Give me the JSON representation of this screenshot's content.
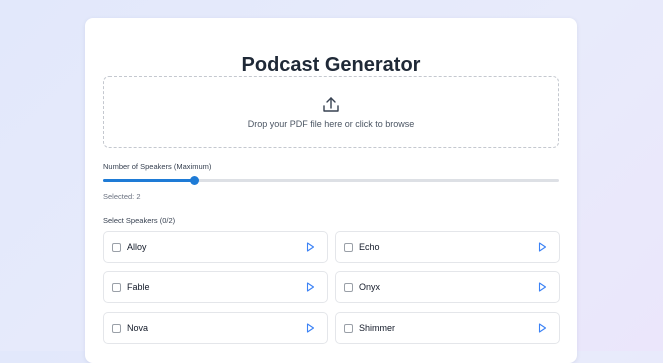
{
  "title": "Podcast Generator",
  "upload": {
    "icon": "upload-icon",
    "text": "Drop your PDF file here or click to browse"
  },
  "speakers_slider": {
    "label": "Number of Speakers (Maximum)",
    "value": 2,
    "fill_fraction": 0.2,
    "selected_text": "Selected: 2"
  },
  "speakers": {
    "label": "Select Speakers (0/2)",
    "items": [
      {
        "name": "Alloy",
        "checked": false
      },
      {
        "name": "Echo",
        "checked": false
      },
      {
        "name": "Fable",
        "checked": false
      },
      {
        "name": "Onyx",
        "checked": false
      },
      {
        "name": "Nova",
        "checked": false
      },
      {
        "name": "Shimmer",
        "checked": false
      }
    ]
  },
  "colors": {
    "accent": "#1e7bd6",
    "play_icon": "#3b82f6",
    "title": "#1f2937"
  }
}
